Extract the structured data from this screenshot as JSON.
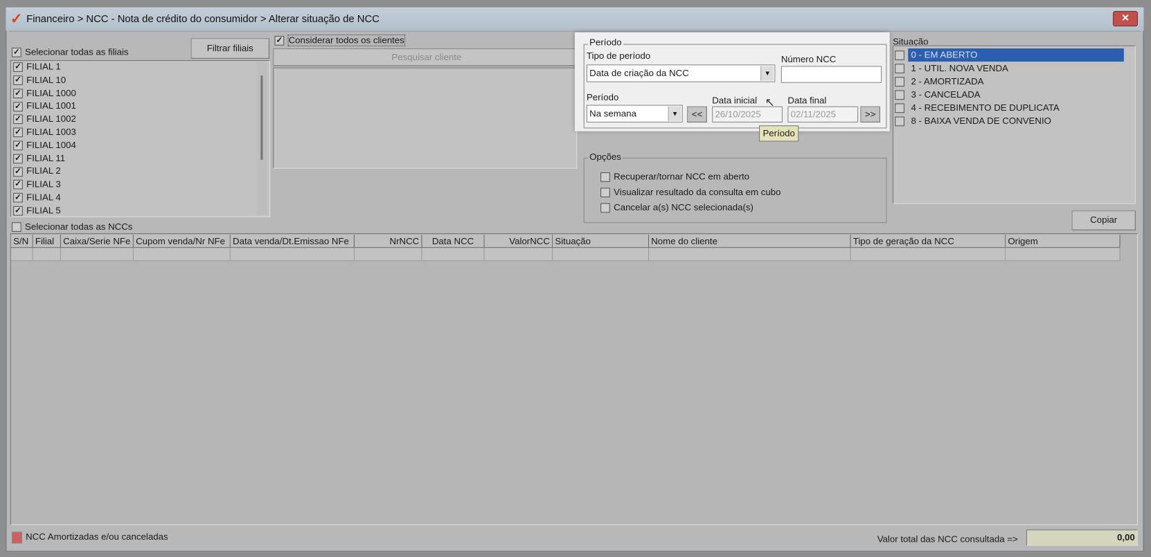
{
  "window": {
    "title": "Financeiro > NCC - Nota de crédito do consumidor > Alterar situação de NCC",
    "logo": "✓",
    "close": "✕"
  },
  "filiais": {
    "select_all_label": "Selecionar todas as filiais",
    "select_all_checked": true,
    "filter_button": "Filtrar filiais",
    "items": [
      "FILIAL 1",
      "FILIAL 10",
      "FILIAL 1000",
      "FILIAL 1001",
      "FILIAL 1002",
      "FILIAL 1003",
      "FILIAL 1004",
      "FILIAL 11",
      "FILIAL 2",
      "FILIAL 3",
      "FILIAL 4",
      "FILIAL 5"
    ]
  },
  "clientes": {
    "consider_all_label": "Considerar todos os clientes",
    "consider_all_checked": true,
    "search_button": "Pesquisar cliente"
  },
  "periodo": {
    "group_label": "Período",
    "tipo_label": "Tipo de período",
    "tipo_value": "Data de criação da NCC",
    "numero_label": "Número NCC",
    "numero_value": "",
    "periodo_label": "Período",
    "periodo_value": "Na semana",
    "prev_button": "<<",
    "next_button": ">>",
    "data_inicial_label": "Data inicial",
    "data_inicial": "26/10/2025",
    "data_final_label": "Data final",
    "data_final": "02/11/2025",
    "tooltip": "Período"
  },
  "opcoes": {
    "group_label": "Opções",
    "items": [
      "Recuperar/tornar NCC em aberto",
      "Visualizar resultado da consulta em cubo",
      "Cancelar a(s) NCC selecionada(s)"
    ]
  },
  "situacao": {
    "label": "Situação",
    "items": [
      "0 - EM ABERTO",
      "1 - UTIL. NOVA VENDA",
      "2 - AMORTIZADA",
      "3 - CANCELADA",
      "4 - RECEBIMENTO DE DUPLICATA",
      "8 - BAIXA VENDA DE CONVENIO"
    ],
    "selected_index": 0
  },
  "copy_button": "Copiar",
  "ncc": {
    "select_all_label": "Selecionar todas as NCCs",
    "columns": [
      "S/N",
      "Filial",
      "Caixa/Serie NFe",
      "Cupom venda/Nr NFe",
      "Data venda/Dt.Emissao NFe",
      "NrNCC",
      "Data NCC",
      "ValorNCC",
      "Situação",
      "Nome do cliente",
      "Tipo de geração da NCC",
      "Origem"
    ]
  },
  "footer": {
    "legend_label": "NCC Amortizadas e/ou canceladas",
    "legend_color": "#d06060",
    "total_label": "Valor total das NCC consultada =>",
    "total_value": "0,00"
  }
}
